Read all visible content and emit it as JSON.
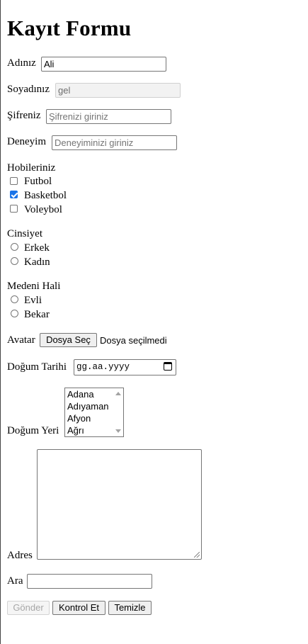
{
  "title": "Kayıt Formu",
  "fields": {
    "ad": {
      "label": "Adınız",
      "value": "Ali"
    },
    "soyad": {
      "label": "Soyadınız",
      "value": "gel"
    },
    "sifre": {
      "label": "Şifreniz",
      "placeholder": "Şifrenizi giriniz"
    },
    "deneyim": {
      "label": "Deneyim",
      "placeholder": "Deneyiminizi giriniz"
    }
  },
  "hobiler": {
    "label": "Hobileriniz",
    "items": [
      {
        "label": "Futbol",
        "checked": false
      },
      {
        "label": "Basketbol",
        "checked": true
      },
      {
        "label": "Voleybol",
        "checked": false
      }
    ]
  },
  "cinsiyet": {
    "label": "Cinsiyet",
    "options": [
      "Erkek",
      "Kadın"
    ]
  },
  "medeni": {
    "label": "Medeni Hali",
    "options": [
      "Evli",
      "Bekar"
    ]
  },
  "avatar": {
    "label": "Avatar",
    "button": "Dosya Seç",
    "status": "Dosya seçilmedi"
  },
  "dogum_tarihi": {
    "label": "Doğum Tarihi",
    "placeholder": "gg.aa.yyyy"
  },
  "dogum_yeri": {
    "label": "Doğum Yeri",
    "options": [
      "Adana",
      "Adıyaman",
      "Afyon",
      "Ağrı"
    ]
  },
  "adres": {
    "label": "Adres"
  },
  "ara": {
    "label": "Ara"
  },
  "buttons": {
    "gonder": "Gönder",
    "kontrol": "Kontrol Et",
    "temizle": "Temizle"
  },
  "colors": {
    "accent": "#1a73e8"
  }
}
